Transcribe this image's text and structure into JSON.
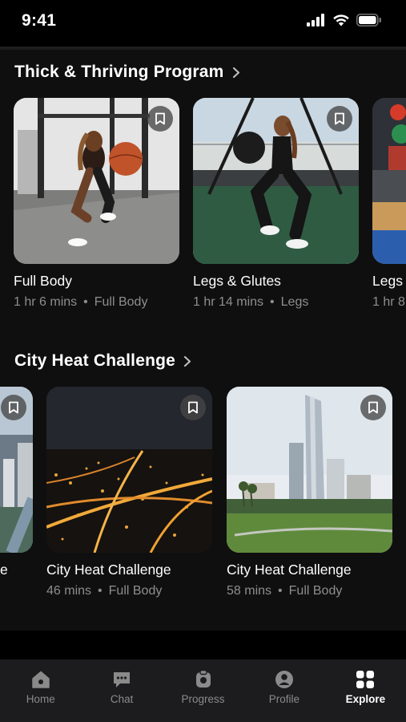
{
  "status": {
    "time": "9:41"
  },
  "sections": [
    {
      "title": "Thick & Thriving Program",
      "cards": [
        {
          "title": "Full Body",
          "duration": "1 hr 6 mins",
          "category": "Full Body"
        },
        {
          "title": "Legs & Glutes",
          "duration": "1 hr 14 mins",
          "category": "Legs"
        },
        {
          "title": "Legs",
          "duration": "1 hr 8",
          "category": ""
        }
      ]
    },
    {
      "title": "City Heat Challenge",
      "cards": [
        {
          "title": "e",
          "duration": "",
          "category": ""
        },
        {
          "title": "City Heat Challenge",
          "duration": "46 mins",
          "category": "Full Body"
        },
        {
          "title": "City Heat Challenge",
          "duration": "58 mins",
          "category": "Full Body"
        }
      ]
    }
  ],
  "meta_separator": "•",
  "tabs": [
    {
      "label": "Home",
      "icon": "home-icon",
      "active": false
    },
    {
      "label": "Chat",
      "icon": "chat-icon",
      "active": false
    },
    {
      "label": "Progress",
      "icon": "progress-icon",
      "active": false
    },
    {
      "label": "Profile",
      "icon": "profile-icon",
      "active": false
    },
    {
      "label": "Explore",
      "icon": "explore-grid-icon",
      "active": true
    }
  ],
  "colors": {
    "background": "#0f0f0f",
    "tab_bar": "#1c1c1e",
    "muted_text": "#8e8e8e",
    "inactive_tab": "#8a8a8a"
  }
}
